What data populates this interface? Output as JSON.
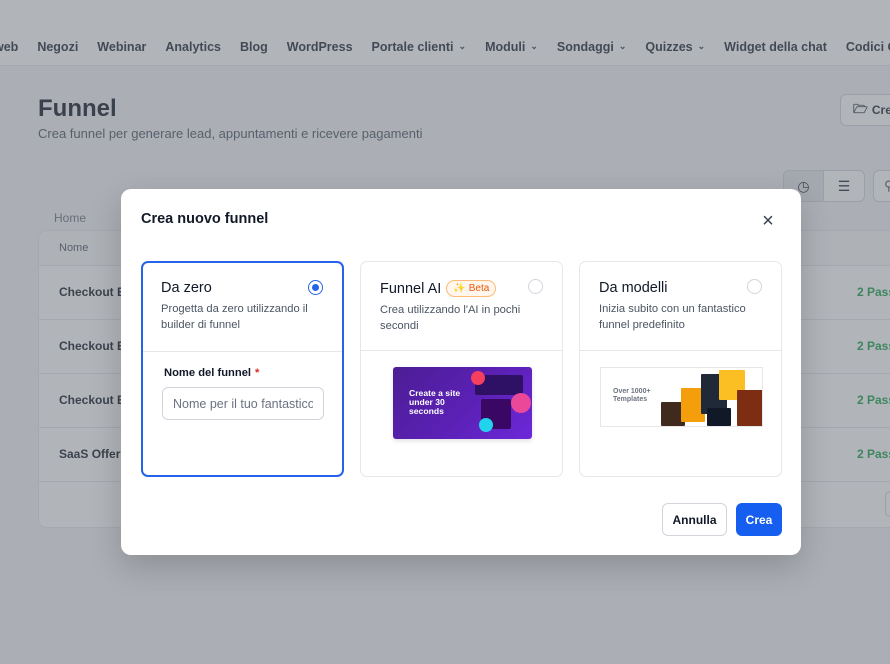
{
  "nav": {
    "items": [
      {
        "label": "web",
        "dropdown": false
      },
      {
        "label": "Negozi",
        "dropdown": false
      },
      {
        "label": "Webinar",
        "dropdown": false
      },
      {
        "label": "Analytics",
        "dropdown": false
      },
      {
        "label": "Blog",
        "dropdown": false
      },
      {
        "label": "WordPress",
        "dropdown": false
      },
      {
        "label": "Portale clienti",
        "dropdown": true
      },
      {
        "label": "Moduli",
        "dropdown": true
      },
      {
        "label": "Sondaggi",
        "dropdown": true
      },
      {
        "label": "Quizzes",
        "dropdown": true
      },
      {
        "label": "Widget della chat",
        "dropdown": false
      },
      {
        "label": "Codici QR",
        "dropdown": false
      }
    ],
    "settings_icon": "gear-icon"
  },
  "page": {
    "title": "Funnel",
    "subtitle": "Crea funnel per generare lead, appuntamenti e ricevere pagamenti",
    "create_button": "Cre",
    "breadcrumb": "Home",
    "table_header": "Nome",
    "rows": [
      {
        "name": "Checkout El",
        "steps": "2 Pass"
      },
      {
        "name": "Checkout Es",
        "steps": "2 Pass"
      },
      {
        "name": "Checkout Ex",
        "steps": "2 Pass"
      },
      {
        "name": "SaaS Offer",
        "steps": "2 Pass"
      }
    ]
  },
  "modal": {
    "title": "Crea nuovo funnel",
    "close_icon": "close-icon",
    "cards": {
      "scratch": {
        "title": "Da zero",
        "description": "Progetta da zero utilizzando il builder di funnel",
        "selected": true,
        "field_label": "Nome del funnel",
        "required_mark": "*",
        "field_placeholder": "Nome per il tuo fantastico funnel",
        "field_value": ""
      },
      "ai": {
        "title": "Funnel AI",
        "badge": "Beta",
        "description": "Crea utilizzando l'AI in pochi secondi",
        "selected": false,
        "image_text": "Create a site under 30 seconds"
      },
      "templates": {
        "title": "Da modelli",
        "description": "Inizia subito con un fantastico funnel predefinito",
        "selected": false,
        "image_text": "Over 1000+ Templates"
      }
    },
    "cancel_label": "Annulla",
    "submit_label": "Crea"
  },
  "colors": {
    "primary": "#155eef",
    "selected_border": "#2563eb",
    "beta_badge": "#ea580c",
    "success_text": "#16a34a",
    "ai_image": "#5b21b6"
  }
}
